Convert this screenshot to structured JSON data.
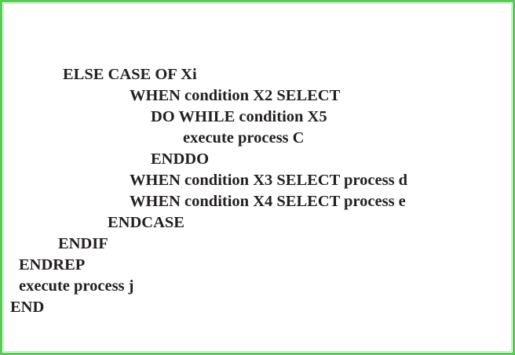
{
  "colors": {
    "border": "#5cc85c",
    "text": "#231f20",
    "background": "#ffffff"
  },
  "code_lines": [
    "ELSE CASE OF Xi",
    "WHEN condition X2 SELECT",
    "DO WHILE condition X5",
    "execute process C",
    "ENDDO",
    "WHEN condition X3 SELECT process d",
    "WHEN condition X4 SELECT process e",
    "ENDCASE",
    "ENDIF",
    "ENDREP",
    "execute process j",
    "END"
  ]
}
